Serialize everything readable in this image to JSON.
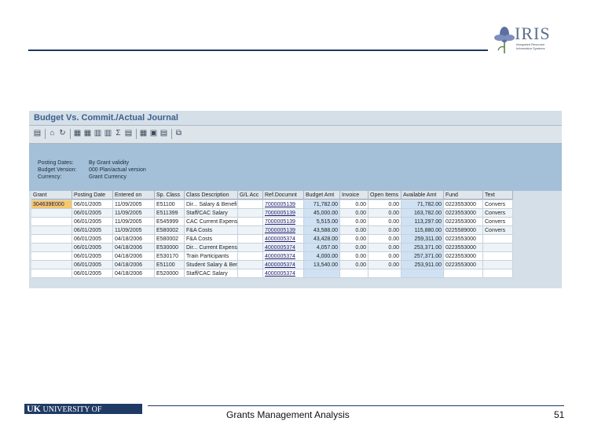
{
  "logo": {
    "name": "IRIS",
    "subtitle": "Integrated Resource Information Systems"
  },
  "window": {
    "title": "Budget Vs. Commit./Actual Journal"
  },
  "header_fields": [
    {
      "label": "Posting Dates:",
      "value": "By Grant validity"
    },
    {
      "label": "Budget Version:",
      "value": "000 Plan/actual version"
    },
    {
      "label": "Currency:",
      "value": "Grant Currency"
    }
  ],
  "columns": [
    "Grant",
    "Posting Date",
    "Entered on",
    "Sp. Class",
    "Class Description",
    "G/L Acc",
    "Ref.Documnt",
    "Budget Amt",
    "Invoice",
    "Open Items",
    "Available Amt",
    "Fund",
    "Text"
  ],
  "rows": [
    [
      "304639E000",
      "06/01/2005",
      "11/09/2005",
      "E51100",
      "Dir... Salary & Benefits",
      "",
      "7000005139",
      "71,782.00",
      "0.00",
      "0.00",
      "71,782.00",
      "0223553000",
      "Convers"
    ],
    [
      "",
      "06/01/2005",
      "11/09/2005",
      "E511399",
      "Staff/CAC Salary",
      "",
      "7000005139",
      "45,000.00",
      "0.00",
      "0.00",
      "163,782.00",
      "0223553000",
      "Convers"
    ],
    [
      "",
      "06/01/2005",
      "11/09/2005",
      "E545999",
      "CAC Current Expenses",
      "",
      "7000005139",
      "5,515.00",
      "0.00",
      "0.00",
      "113,297.00",
      "0223553000",
      "Convers"
    ],
    [
      "",
      "06/01/2005",
      "11/09/2005",
      "E580002",
      "F&A Costs",
      "",
      "7000005139",
      "43,588.00",
      "0.00",
      "0.00",
      "115,880.00",
      "0225589000",
      "Convers"
    ],
    [
      "",
      "06/01/2005",
      "04/18/2006",
      "E580002",
      "F&A Costs",
      "",
      "4000005374",
      "43,428.00",
      "0.00",
      "0.00",
      "259,311.00",
      "0223553000",
      ""
    ],
    [
      "",
      "06/01/2005",
      "04/18/2006",
      "E530000",
      "Dir... Current Expenses",
      "",
      "4000005374",
      "4,057.00",
      "0.00",
      "0.00",
      "253,371.00",
      "0223553000",
      ""
    ],
    [
      "",
      "06/01/2005",
      "04/18/2006",
      "E530170",
      "Train Participants",
      "",
      "4000005374",
      "4,000.00",
      "0.00",
      "0.00",
      "257,371.00",
      "0223553000",
      ""
    ],
    [
      "",
      "06/01/2005",
      "04/18/2006",
      "E51100",
      "Student Salary & Benefits",
      "",
      "4000005374",
      "13,540.00",
      "0.00",
      "0.00",
      "253,911.00",
      "0223553000",
      ""
    ],
    [
      "",
      "06/01/2005",
      "04/18/2006",
      "E520000",
      "Staff/CAC Salary",
      "",
      "4000005374",
      "",
      "",
      "",
      "",
      "",
      ""
    ]
  ],
  "footer": {
    "university": "UNIVERSITY OF KENTUCKY",
    "university_prefix": "UK",
    "title": "Grants Management Analysis",
    "page": "51"
  },
  "colors": {
    "rule": "#1f3a64",
    "header_band": "#a4c0d8",
    "title": "#3d5f8f",
    "selected": "#f5c86a",
    "amount_col": "#cfe1f2"
  }
}
